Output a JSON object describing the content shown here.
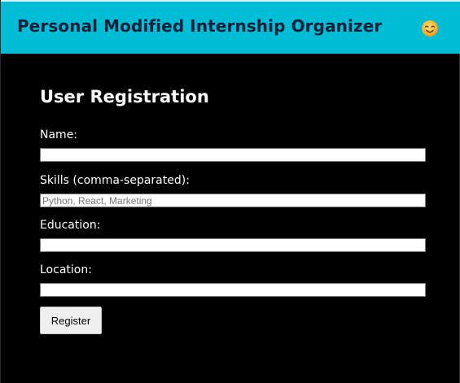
{
  "header": {
    "title": "Personal Modified Internship Organizer",
    "emoji_icon": "smiling-face-icon"
  },
  "form": {
    "heading": "User Registration",
    "fields": [
      {
        "label": "Name:",
        "value": "",
        "placeholder": ""
      },
      {
        "label": "Skills (comma-separated):",
        "value": "",
        "placeholder": "Python, React, Marketing"
      },
      {
        "label": "Education:",
        "value": "",
        "placeholder": ""
      },
      {
        "label": "Location:",
        "value": "",
        "placeholder": ""
      }
    ],
    "submit_label": "Register"
  },
  "colors": {
    "header_bg": "#00bcd4",
    "header_text": "#0e1f3a",
    "page_bg": "#000000",
    "text": "#ffffff"
  }
}
